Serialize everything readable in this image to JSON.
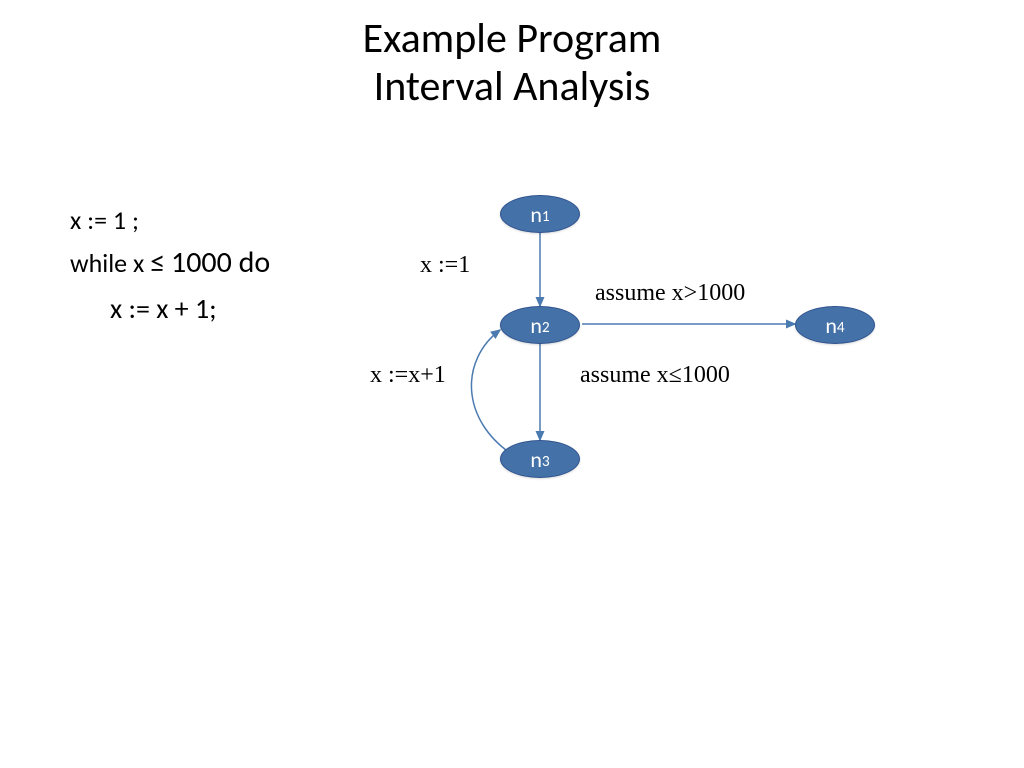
{
  "title_line1": "Example Program",
  "title_line2": "Interval Analysis",
  "code": {
    "line1": "x := 1 ;",
    "line2_prefix": "while x",
    "line2_op": "≤",
    "line2_suffix": "1000 do",
    "line3": "x := x + 1;"
  },
  "nodes": {
    "n1": {
      "letter": "n",
      "sub": "1"
    },
    "n2": {
      "letter": "n",
      "sub": "2"
    },
    "n3": {
      "letter": "n",
      "sub": "3"
    },
    "n4": {
      "letter": "n",
      "sub": "4"
    }
  },
  "edge_labels": {
    "x_assign_1": "x :=1",
    "x_assign_xp1": "x :=x+1",
    "assume_gt": "assume x>1000",
    "assume_le": "assume x≤1000"
  },
  "colors": {
    "node_fill": "#4472a8",
    "node_stroke": "#2f528f",
    "edge": "#4a7ab0"
  }
}
